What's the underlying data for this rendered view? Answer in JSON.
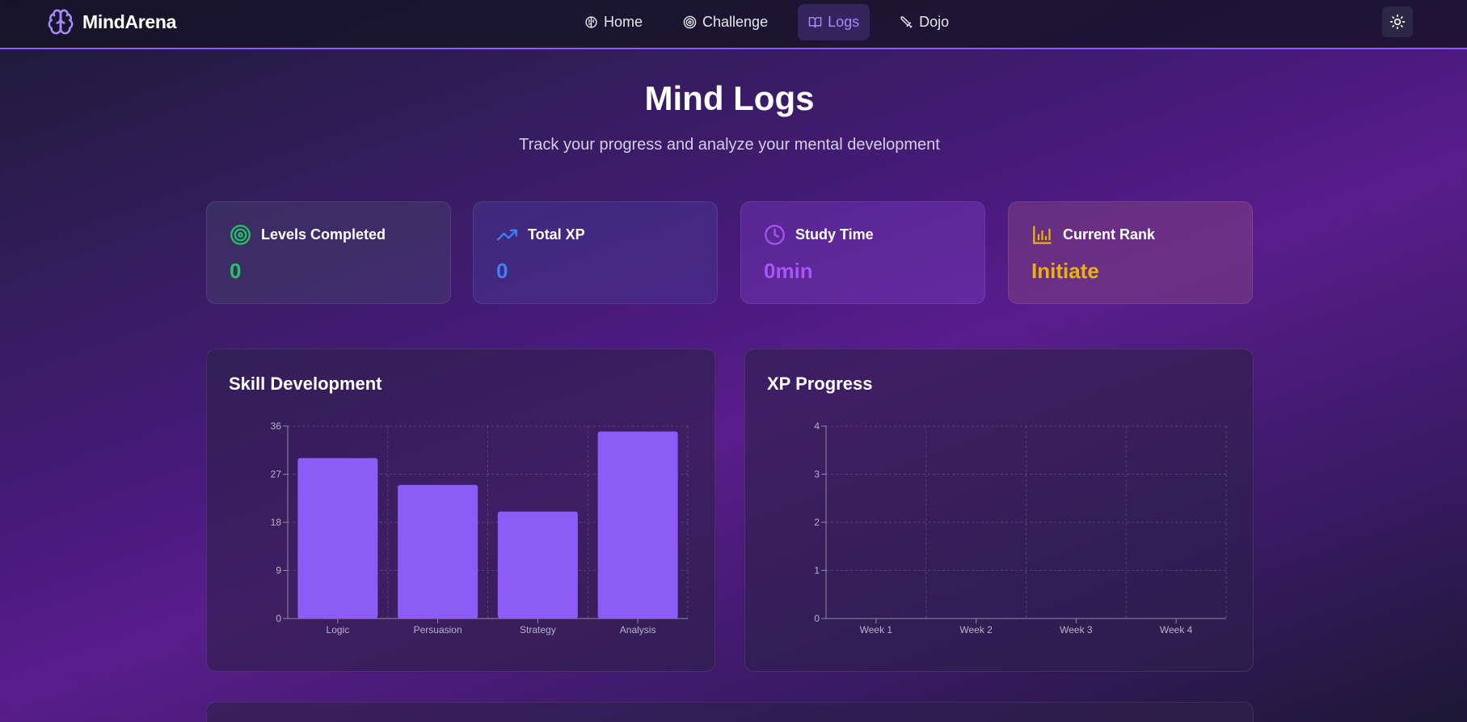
{
  "app": {
    "name": "MindArena",
    "logo_icon": "brain-icon"
  },
  "nav": {
    "items": [
      {
        "label": "Home",
        "icon": "brain-icon",
        "active": false
      },
      {
        "label": "Challenge",
        "icon": "target-icon",
        "active": false
      },
      {
        "label": "Logs",
        "icon": "book-open-icon",
        "active": true
      },
      {
        "label": "Dojo",
        "icon": "sword-icon",
        "active": false
      }
    ],
    "theme_toggle_icon": "sun-icon"
  },
  "header": {
    "title": "Mind Logs",
    "subtitle": "Track your progress and analyze your mental development"
  },
  "stats": [
    {
      "label": "Levels Completed",
      "value": "0",
      "icon": "target-icon",
      "color": "#22c55e"
    },
    {
      "label": "Total XP",
      "value": "0",
      "icon": "trending-up-icon",
      "color": "#3b82f6"
    },
    {
      "label": "Study Time",
      "value": "0min",
      "icon": "clock-icon",
      "color": "#a855f7"
    },
    {
      "label": "Current Rank",
      "value": "Initiate",
      "icon": "bar-chart-icon",
      "color": "#eab308"
    }
  ],
  "panels": {
    "skills_title": "Skill Development",
    "xp_title": "XP Progress"
  },
  "colors": {
    "accent": "#8b5cf6",
    "bar": "#8b5cf6"
  },
  "chart_data": [
    {
      "type": "bar",
      "title": "Skill Development",
      "categories": [
        "Logic",
        "Persuasion",
        "Strategy",
        "Analysis"
      ],
      "values": [
        30,
        25,
        20,
        35
      ],
      "ylim": [
        0,
        36
      ],
      "yticks": [
        0,
        9,
        18,
        27,
        36
      ],
      "grid": true
    },
    {
      "type": "line",
      "title": "XP Progress",
      "categories": [
        "Week 1",
        "Week 2",
        "Week 3",
        "Week 4"
      ],
      "values": [],
      "ylim": [
        0,
        4
      ],
      "yticks": [
        0,
        1,
        2,
        3,
        4
      ],
      "grid": true
    }
  ]
}
